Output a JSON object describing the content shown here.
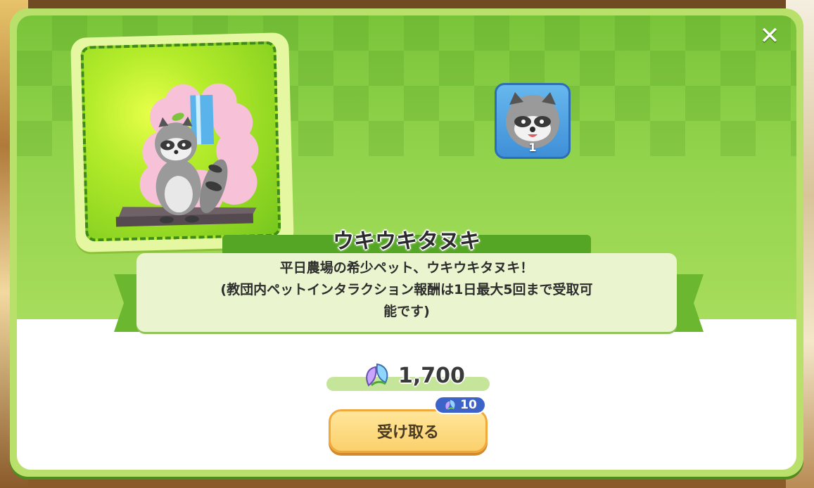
{
  "colors": {
    "accent_green": "#56a626",
    "button_orange": "#fbd06c",
    "badge_blue": "#3e63c8"
  },
  "modal": {
    "close_icon": "close-icon"
  },
  "reward": {
    "icon": "raccoon-icon",
    "count": "1"
  },
  "pet": {
    "name": "ウキウキタヌキ",
    "description_line1": "平日農場の希少ペット、ウキウキタヌキ！",
    "description_line2": "(教団内ペットインタラクション報酬は1日最大5回まで受取可",
    "description_line3": "能です)"
  },
  "price": {
    "icon": "crystal-leaf-icon",
    "value": "1,700"
  },
  "claim": {
    "label": "受け取る",
    "badge_icon": "crystal-leaf-icon",
    "badge_count": "10"
  }
}
